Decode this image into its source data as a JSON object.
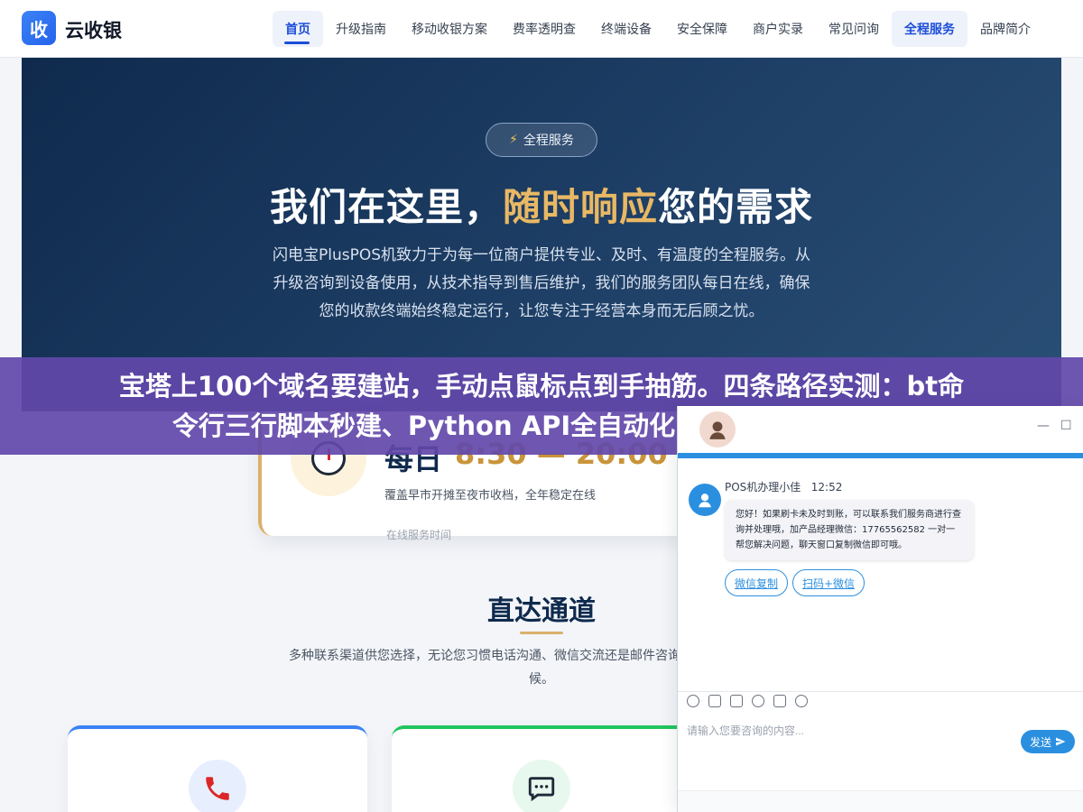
{
  "header": {
    "logo_glyph": "收",
    "brand": "云收银",
    "nav": [
      "首页",
      "升级指南",
      "移动收银方案",
      "费率透明查",
      "终端设备",
      "安全保障",
      "商户实录",
      "常见问询",
      "全程服务",
      "品牌简介"
    ]
  },
  "hero": {
    "badge_icon": "⚡",
    "badge": "全程服务",
    "title_part1": "我们在这里，",
    "title_highlight": "随时响应",
    "title_part2": "您的需求",
    "description": "闪电宝PlusPOS机致力于为每一位商户提供专业、及时、有温度的全程服务。从升级咨询到设备使用，从技术指导到售后维护，我们的服务团队每日在线，确保您的收款终端始终稳定运行，让您专注于经营本身而无后顾之忧。"
  },
  "banner": {
    "line1": "宝塔上100个域名要建站，手动点鼠标点到手抽筋。四条路径实测：bt命",
    "line2": "令行三行脚本秒建、Python API全自动化，完整代码直接抄走"
  },
  "hours": {
    "label": "每日",
    "time": "8:30 — 20:00",
    "sub": "覆盖早市开摊至夜市收档，全年稳定在线",
    "faint": "在线服务时间"
  },
  "section": {
    "title": "直达通道",
    "description": "多种联系渠道供您选择，无论您习惯电话沟通、微信交流还是邮件咨询，我们都在另一端守候。"
  },
  "chat": {
    "minimize": "—",
    "maximize": "☐",
    "agent_name": "POS机办理小佳",
    "time": "12:52",
    "message": "您好！如果刷卡未及时到账，可以联系我们服务商进行查询并处理哦，加产品经理微信：17765562582 一对一帮您解决问题，聊天窗口复制微信即可哦。",
    "btn_copy": "微信复制",
    "btn_scan": "扫码+微信",
    "input_placeholder": "请输入您要咨询的内容...",
    "send": "发送"
  }
}
